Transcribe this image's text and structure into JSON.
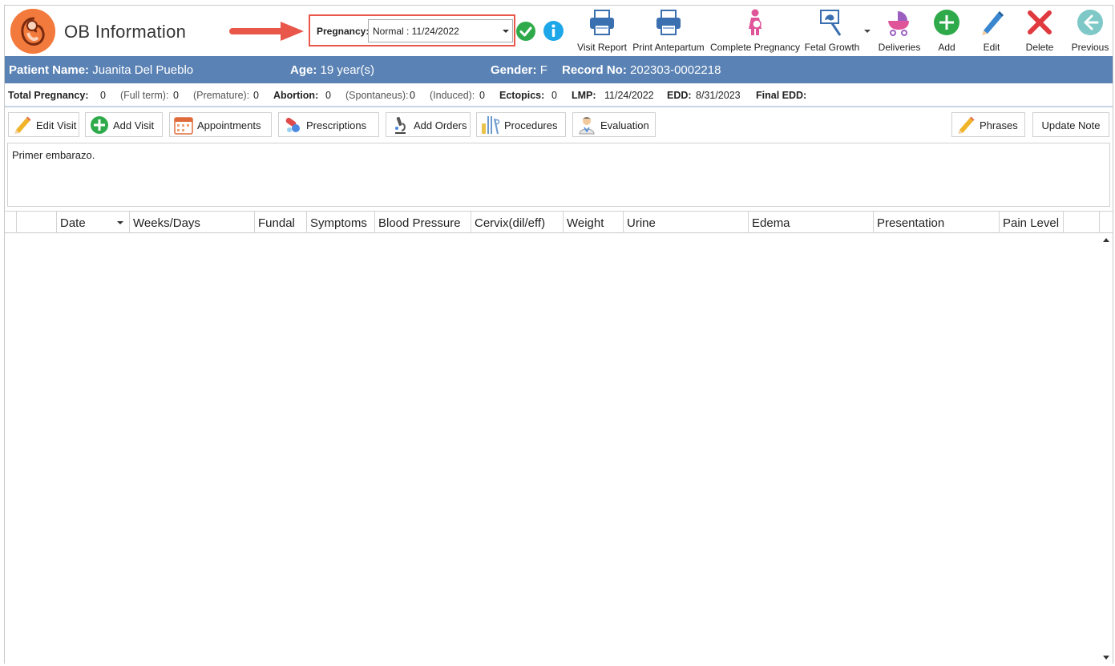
{
  "app": {
    "title": "OB Information"
  },
  "pregnancy": {
    "label": "Pregnancy:",
    "selected": "Normal : 11/24/2022"
  },
  "toolbar": {
    "visit_report": "Visit Report",
    "print_antepartum": "Print Antepartum",
    "complete_pregnancy": "Complete Pregnancy",
    "fetal_growth": "Fetal Growth",
    "deliveries": "Deliveries",
    "add": "Add",
    "edit": "Edit",
    "delete": "Delete",
    "previous": "Previous"
  },
  "patient": {
    "name_label": "Patient Name:",
    "name": "Juanita Del Pueblo",
    "age_label": "Age:",
    "age": "19 year(s)",
    "gender_label": "Gender:",
    "gender": "F",
    "record_label": "Record No:",
    "record": "202303-0002218"
  },
  "summary": {
    "total_label": "Total Pregnancy:",
    "total": "0",
    "fullterm_label": "(Full term):",
    "fullterm": "0",
    "premature_label": "(Premature):",
    "premature": "0",
    "abortion_label": "Abortion:",
    "abortion": "0",
    "spontaneous_label": "(Spontaneus):",
    "spontaneous": "0",
    "induced_label": "(Induced):",
    "induced": "0",
    "ectopics_label": "Ectopics:",
    "ectopics": "0",
    "lmp_label": "LMP:",
    "lmp": "11/24/2022",
    "edd_label": "EDD:",
    "edd": "8/31/2023",
    "final_edd_label": "Final EDD:"
  },
  "actions": {
    "edit_visit": "Edit Visit",
    "add_visit": "Add Visit",
    "appointments": "Appointments",
    "prescriptions": "Prescriptions",
    "add_orders": "Add Orders",
    "procedures": "Procedures",
    "evaluation": "Evaluation",
    "phrases": "Phrases",
    "update_note": "Update Note"
  },
  "notes": {
    "text": "Primer embarazo."
  },
  "grid": {
    "columns": [
      "",
      "Date",
      "Weeks/Days",
      "Fundal",
      "Symptoms",
      "Blood Pressure",
      "Cervix(dil/eff)",
      "Weight",
      "Urine",
      "Edema",
      "Presentation",
      "Pain Level",
      ""
    ],
    "rows": []
  },
  "colors": {
    "accent_bar": "#5a82b4",
    "highlight_border": "#e8574a",
    "logo": "#f27a3c",
    "ok_green": "#2eaa4a",
    "info_blue": "#1ea7e8"
  },
  "icons": [
    "fetus-logo-icon",
    "arrow-right-icon",
    "check-circle-icon",
    "info-icon",
    "printer-icon",
    "pregnant-woman-icon",
    "ultrasound-icon",
    "baby-carriage-icon",
    "plus-circle-icon",
    "pencil-icon",
    "x-icon",
    "back-arrow-icon",
    "calendar-icon",
    "pills-icon",
    "microscope-icon",
    "instruments-icon",
    "doctor-icon"
  ]
}
